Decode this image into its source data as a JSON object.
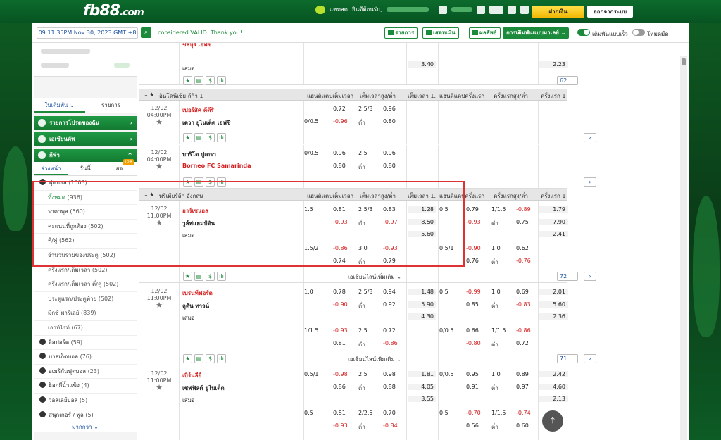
{
  "brand": {
    "logo_main": "fb88",
    "logo_suffix": ".com"
  },
  "header": {
    "chat_label": "แชทสด",
    "welcome_label": "ยินดีต้อนรับ,",
    "deposit_button": "ฝากเงิน",
    "logout_button": "ออกจากระบบ"
  },
  "subbar": {
    "datetime": "09:11:35PM Nov 30, 2023 GMT +8",
    "message": "considered VALID. Thank you!",
    "btn_list": "รายการ",
    "btn_live": "เสดทเม้น",
    "btn_results": "ผลลัพธ์",
    "btn_betting": "การเดิมพันแบบมาเลย์",
    "quick_bet": "เดิมพันแบบเร็ว",
    "dark_mode": "โหมดมืด"
  },
  "sidebar": {
    "tab_slip": "ใบเดิมพัน",
    "tab_list": "รายการ",
    "fav_bar": "รายการโปรดของฉัน",
    "esports_bar": "เอเชียนคัพ",
    "sports_bar": "กีฬา",
    "sub_early": "ล่วงหน้า",
    "sub_today": "วันนี้",
    "sub_live": "สด",
    "live_badge": "128",
    "football": "ฟุตบอล",
    "football_count": "(1003)",
    "items": [
      {
        "label": "ทั้งหมด",
        "count": "(936)"
      },
      {
        "label": "ราคาพูล",
        "count": "(560)"
      },
      {
        "label": "คะแนนที่ถูกต้อง",
        "count": "(502)"
      },
      {
        "label": "คี่/คู่",
        "count": "(562)"
      },
      {
        "label": "จำนวนรวมของประตู",
        "count": "(502)"
      },
      {
        "label": "ครึ่งแรก/เต็มเวลา",
        "count": "(502)"
      },
      {
        "label": "ครึ่งแรก/เต็มเวลา คี่/คู่",
        "count": "(502)"
      },
      {
        "label": "ประตูแรก/ประตูท้าย",
        "count": "(502)"
      },
      {
        "label": "มิกซ์ พาร์เลย์",
        "count": "(839)"
      },
      {
        "label": "เอาท์ไรท์",
        "count": "(67)"
      }
    ],
    "sports": [
      {
        "label": "อีสปอร์ต",
        "count": "(59)"
      },
      {
        "label": "บาสเก็ตบอล",
        "count": "(76)"
      },
      {
        "label": "อเมริกันฟุตบอล",
        "count": "(23)"
      },
      {
        "label": "ฮ็อกกี้น้ำแข็ง",
        "count": "(4)"
      },
      {
        "label": "วอลเลย์บอล",
        "count": "(5)"
      },
      {
        "label": "สนุกเกอร์ / พูล",
        "count": "(5)"
      }
    ],
    "more": "มากกว่า"
  },
  "col_headers": {
    "ft_hdp": "แฮนดิแคปเต็มเวลา",
    "ft_ou": "เต็มเวลาสูง/ต่ำ",
    "ft_1x2": "เต็มเวลา 1...",
    "ht_hdp": "แฮนดิแคปครึ่งแรก",
    "ht_ou": "ครึ่งแรกสูง/ต่ำ",
    "ht_1x2": "ครึ่งแรก 1..."
  },
  "top_partial": {
    "draw": "เสมอ",
    "partial_name": "ชลบุรี เอฟซี",
    "v1": "3.40",
    "v2": "2.23",
    "count": "62"
  },
  "leagues": [
    {
      "name": "อินโดนีเซีย ลีก้า 1"
    },
    {
      "name": "พรีเมียร์ลีก อังกฤษ"
    }
  ],
  "matches": {
    "m1": {
      "date": "12/02",
      "time": "04:00PM",
      "home": "เปอร์สิค คีดีริ",
      "away": "เดวา ยูไนเต็ด เอฟซี",
      "hdp": "0/0.5",
      "h_home": "0.72",
      "h_away": "-0.96",
      "ou": "2.5/3",
      "o": "0.96",
      "u_label": "ต่ำ",
      "u": "0.80"
    },
    "m2": {
      "date": "12/02",
      "time": "04:00PM",
      "home": "บาริโต ปูเตรา",
      "away": "Borneo FC Samarinda",
      "hdp": "0/0.5",
      "h_home": "0.96",
      "h_away": "0.80",
      "ou": "2.5",
      "o": "0.96",
      "u_label": "ต่ำ",
      "u": "0.80"
    },
    "m3": {
      "date": "12/02",
      "time": "11:00PM",
      "home": "อาร์เซนอล",
      "away": "วูล์ฟแฮมป์ตัน",
      "draw": "เสมอ",
      "r1": {
        "hdp": "1.5",
        "hh": "0.81",
        "ha": "-0.93",
        "ou": "2.5/3",
        "o": "0.83",
        "ul": "ต่ำ",
        "u": "-0.97",
        "x1": "1.28",
        "x2": "8.50",
        "xd": "5.60",
        "hhdp": "0.5",
        "hhh": "0.79",
        "hha": "-0.93",
        "hou": "1/1.5",
        "ho": "-0.89",
        "hul": "ต่ำ",
        "hu": "0.75",
        "hx1": "1.79",
        "hx2": "7.90",
        "hxd": "2.41"
      },
      "r2": {
        "hdp": "1.5/2",
        "hh": "-0.86",
        "ha": "0.74",
        "ou": "3.0",
        "o": "-0.93",
        "ul": "ต่ำ",
        "u": "0.79",
        "hhdp": "0.5/1",
        "hhh": "-0.90",
        "hha": "0.76",
        "hou": "1.0",
        "ho": "0.62",
        "hul": "ต่ำ",
        "hu": "-0.76"
      },
      "more_lines": "เอเชียนไลน์เพิ่มเติม",
      "count": "72"
    },
    "m4": {
      "date": "12/02",
      "time": "11:00PM",
      "home": "เบรนท์ฟอร์ด",
      "away": "ลูตัน ทาวน์",
      "draw": "เสมอ",
      "r1": {
        "hdp": "1.0",
        "hh": "0.78",
        "ha": "-0.90",
        "ou": "2.5/3",
        "o": "0.94",
        "ul": "ต่ำ",
        "u": "0.92",
        "x1": "1.48",
        "x2": "5.90",
        "xd": "4.30",
        "hhdp": "0.5",
        "hhh": "-0.99",
        "hha": "0.85",
        "hou": "1.0",
        "ho": "0.69",
        "hul": "ต่ำ",
        "hu": "-0.83",
        "hx1": "2.01",
        "hx2": "5.60",
        "hxd": "2.36"
      },
      "r2": {
        "hdp": "1/1.5",
        "hh": "-0.93",
        "ha": "0.81",
        "ou": "2.5",
        "o": "0.72",
        "ul": "ต่ำ",
        "u": "-0.86",
        "hhdp": "0/0.5",
        "hhh": "0.66",
        "hha": "-0.80",
        "hou": "1/1.5",
        "ho": "-0.86",
        "hul": "ต่ำ",
        "hu": "0.72"
      },
      "more_lines": "เอเชียนไลน์เพิ่มเติม",
      "count": "71"
    },
    "m5": {
      "date": "12/02",
      "time": "11:00PM",
      "home": "เบิร์นลีย์",
      "away": "เชฟฟิลด์ ยูไนเต็ด",
      "draw": "เสมอ",
      "r1": {
        "hdp": "0.5/1",
        "hh": "-0.98",
        "ha": "0.86",
        "ou": "2.5",
        "o": "0.98",
        "ul": "ต่ำ",
        "u": "0.88",
        "x1": "1.81",
        "x2": "4.05",
        "xd": "3.55",
        "hhdp": "0/0.5",
        "hhh": "0.95",
        "hha": "0.91",
        "hou": "1.0",
        "ho": "0.89",
        "hul": "ต่ำ",
        "hu": "0.97",
        "hx1": "2.42",
        "hx2": "4.60",
        "hxd": "2.13"
      },
      "r2": {
        "hdp": "0.5",
        "hh": "0.81",
        "ha": "-0.93",
        "ou": "2/2.5",
        "o": "0.70",
        "ul": "ต่ำ",
        "u": "-0.84",
        "hhdp": "0.5",
        "hhh": "-0.70",
        "hha": "0.56",
        "hou": "1/1.5",
        "ho": "-0.74",
        "hul": "ต่ำ",
        "hu": "0.60"
      }
    }
  },
  "colors": {
    "brand_green": "#1b8a3a",
    "odds_red": "#d42020",
    "highlight": "#dd3333",
    "deposit": "#f2b705"
  }
}
